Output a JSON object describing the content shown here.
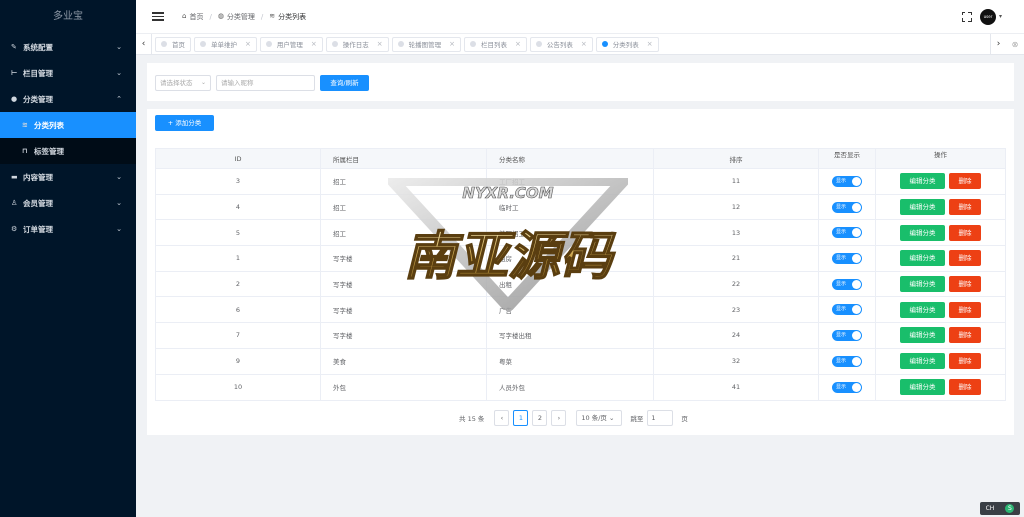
{
  "app": {
    "logo": "多业宝"
  },
  "sidebar": {
    "items": [
      {
        "label": "系统配置",
        "icon": "wrench-icon",
        "glyph": "✎",
        "arrow": "⌄"
      },
      {
        "label": "栏目管理",
        "icon": "columns-icon",
        "glyph": "⊢",
        "arrow": "⌄"
      },
      {
        "label": "分类管理",
        "icon": "category-icon",
        "glyph": "●",
        "arrow": "⌃",
        "children": [
          {
            "label": "分类列表",
            "icon": "list-icon",
            "glyph": "≋",
            "active": true
          },
          {
            "label": "标签管理",
            "icon": "tag-icon",
            "glyph": "⊓"
          }
        ]
      },
      {
        "label": "内容管理",
        "icon": "folder-icon",
        "glyph": "▬",
        "arrow": "⌄"
      },
      {
        "label": "会员管理",
        "icon": "user-icon",
        "glyph": "♙",
        "arrow": "⌄"
      },
      {
        "label": "订单管理",
        "icon": "order-icon",
        "glyph": "⚙",
        "arrow": "⌄"
      }
    ]
  },
  "header": {
    "breadcrumb": [
      {
        "label": "首页",
        "icon": "home-icon",
        "glyph": "⌂"
      },
      {
        "label": "分类管理",
        "icon": "category-icon",
        "glyph": "◍"
      },
      {
        "label": "分类列表",
        "icon": "list-icon",
        "glyph": "≋"
      }
    ],
    "avatar_text": "user"
  },
  "tabs": [
    {
      "label": "首页",
      "closable": false
    },
    {
      "label": "单单维护",
      "closable": true
    },
    {
      "label": "用户管理",
      "closable": true
    },
    {
      "label": "操作日志",
      "closable": true
    },
    {
      "label": "轮播图管理",
      "closable": true
    },
    {
      "label": "栏目列表",
      "closable": true
    },
    {
      "label": "公告列表",
      "closable": true
    },
    {
      "label": "分类列表",
      "closable": true,
      "active": true
    }
  ],
  "search": {
    "select_placeholder": "请选择状态",
    "input_placeholder": "请输入昵称",
    "query_button": "查询/刷新"
  },
  "toolbar": {
    "add_button": "+ 添加分类"
  },
  "table": {
    "headers": {
      "id": "ID",
      "column": "所属栏目",
      "name": "分类名称",
      "sort": "排序",
      "show": "是否显示",
      "op": "操作"
    },
    "rows": [
      {
        "id": "3",
        "column": "招工",
        "name": "工厂招工",
        "sort": "11"
      },
      {
        "id": "4",
        "column": "招工",
        "name": "临时工",
        "sort": "12"
      },
      {
        "id": "5",
        "column": "招工",
        "name": "兼职招工",
        "sort": "13"
      },
      {
        "id": "1",
        "column": "写字楼",
        "name": "租房",
        "sort": "21"
      },
      {
        "id": "2",
        "column": "写字楼",
        "name": "出租",
        "sort": "22"
      },
      {
        "id": "6",
        "column": "写字楼",
        "name": "广告",
        "sort": "23"
      },
      {
        "id": "7",
        "column": "写字楼",
        "name": "写字楼出租",
        "sort": "24"
      },
      {
        "id": "9",
        "column": "美食",
        "name": "粤菜",
        "sort": "32"
      },
      {
        "id": "10",
        "column": "外包",
        "name": "人员外包",
        "sort": "41"
      }
    ],
    "switch_label": "显示",
    "edit_label": "编辑分类",
    "delete_label": "删除"
  },
  "pagination": {
    "total_text": "共 15 条",
    "pages": [
      "1",
      "2"
    ],
    "current": "1",
    "page_size": "10 条/页",
    "jump_label": "跳至",
    "jump_value": "1",
    "page_label": "页"
  },
  "watermark": {
    "top_text": "NYXR.COM",
    "main_text": "南亚源码"
  },
  "tray": {
    "text": "CH"
  },
  "colors": {
    "primary": "#1890ff",
    "sidebar": "#001529",
    "success": "#19be6b",
    "danger": "#ed4014"
  }
}
